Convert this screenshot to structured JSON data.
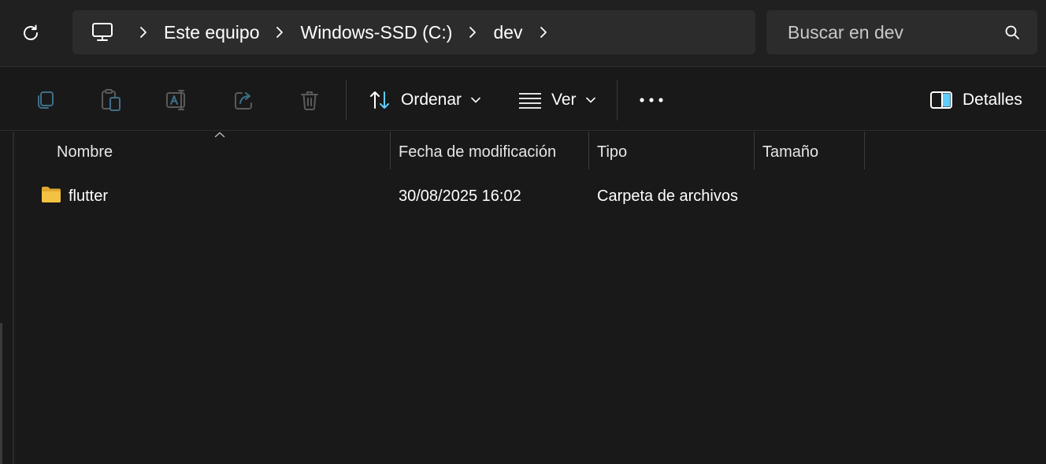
{
  "breadcrumb": {
    "root_icon": "computer-icon",
    "items": [
      {
        "label": "Este equipo"
      },
      {
        "label": "Windows-SSD (C:)"
      },
      {
        "label": "dev"
      }
    ]
  },
  "search": {
    "placeholder": "Buscar en dev"
  },
  "command_bar": {
    "actions": [
      {
        "name": "copy",
        "icon": "copy-icon",
        "enabled": false
      },
      {
        "name": "paste",
        "icon": "paste-icon",
        "enabled": false
      },
      {
        "name": "rename",
        "icon": "rename-icon",
        "enabled": false
      },
      {
        "name": "share",
        "icon": "share-icon",
        "enabled": false
      },
      {
        "name": "delete",
        "icon": "trash-icon",
        "enabled": false
      }
    ],
    "sort_label": "Ordenar",
    "view_label": "Ver",
    "more_icon": "more-icon",
    "details_label": "Detalles"
  },
  "columns": [
    {
      "key": "name",
      "label": "Nombre"
    },
    {
      "key": "modified",
      "label": "Fecha de modificación"
    },
    {
      "key": "type",
      "label": "Tipo"
    },
    {
      "key": "size",
      "label": "Tamaño"
    }
  ],
  "files": [
    {
      "name": "flutter",
      "modified": "30/08/2025 16:02",
      "type": "Carpeta de archivos",
      "size": "",
      "icon": "folder-icon"
    }
  ],
  "colors": {
    "accent": "#60cdff",
    "folder": "#f3c242",
    "background": "#191919",
    "toolbar": "#202020",
    "input_bg": "#2c2c2c"
  }
}
